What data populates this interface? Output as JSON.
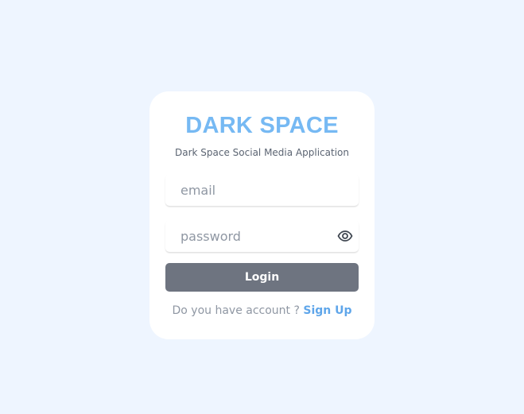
{
  "brand": {
    "title": "DARK SPACE",
    "subtitle": "Dark Space Social Media Application",
    "color": "#76b9f3"
  },
  "form": {
    "email_placeholder": "email",
    "password_placeholder": "password",
    "password_toggle_icon": "eye-icon",
    "login_label": "Login",
    "login_color": "#6e7480"
  },
  "footer": {
    "prompt": "Do you have account ? ",
    "signup_label": "Sign Up",
    "link_color": "#5fa6ea"
  },
  "page": {
    "background": "#eef5ff"
  }
}
